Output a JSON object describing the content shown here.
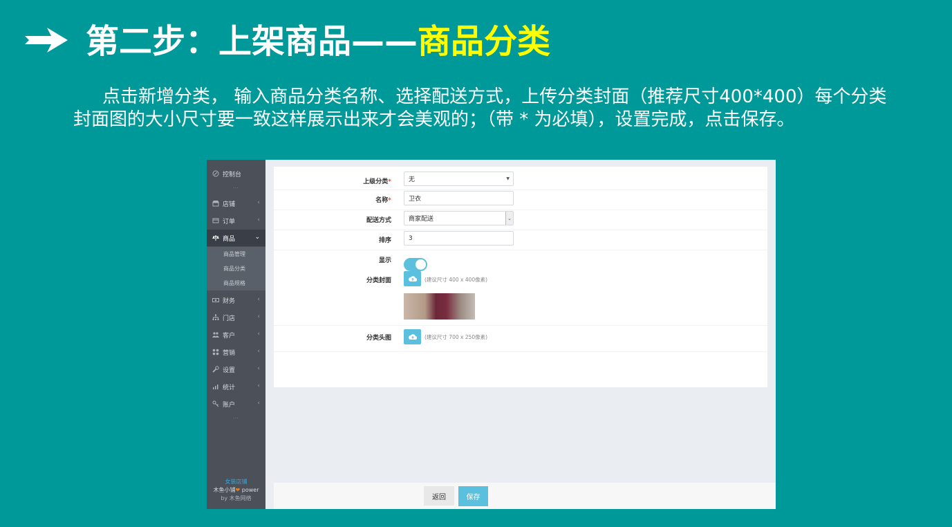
{
  "slide": {
    "title_main": "第二步：上架商品——",
    "title_highlight": "商品分类",
    "description": "点击新增分类， 输入商品分类名称、选择配送方式，上传分类封面（推荐尺寸400*400）每个分类封面图的大小尺寸要一致这样展示出来才会美观的；（带 * 为必填），设置完成，点击保存。"
  },
  "sidebar": {
    "items": [
      {
        "label": "控制台",
        "icon": "dashboard-icon"
      },
      {
        "label": "店铺",
        "icon": "store-icon"
      },
      {
        "label": "订单",
        "icon": "order-icon"
      },
      {
        "label": "商品",
        "icon": "scale-icon"
      },
      {
        "label": "财务",
        "icon": "money-icon"
      },
      {
        "label": "门店",
        "icon": "sitemap-icon"
      },
      {
        "label": "客户",
        "icon": "users-icon"
      },
      {
        "label": "营销",
        "icon": "grid-icon"
      },
      {
        "label": "设置",
        "icon": "wrench-icon"
      },
      {
        "label": "统计",
        "icon": "bar-chart-icon"
      },
      {
        "label": "账户",
        "icon": "key-icon"
      }
    ],
    "sub_items": [
      "商品管理",
      "商品分类",
      "商品规格"
    ],
    "dots": "...",
    "footer": {
      "shop_name": "女装店铺",
      "brand": "木鱼小铺",
      "power": "power",
      "by": "by 木鱼网络"
    }
  },
  "form": {
    "parent_category": {
      "label": "上级分类",
      "value": "无"
    },
    "name": {
      "label": "名称",
      "value": "卫衣"
    },
    "delivery": {
      "label": "配送方式",
      "value": "商家配送"
    },
    "sort": {
      "label": "排序",
      "value": "3"
    },
    "display": {
      "label": "显示",
      "value": true
    },
    "cover": {
      "label": "分类封面",
      "hint": "(建议尺寸 400 x 400像素)"
    },
    "header_img": {
      "label": "分类头图",
      "hint": "(建议尺寸 700 x 250像素)"
    },
    "required_mark": "*"
  },
  "footer": {
    "back_label": "返回",
    "save_label": "保存"
  },
  "colors": {
    "background": "#009999",
    "title_highlight": "#ffff00",
    "accent": "#5bc0de",
    "sidebar": "#4b5059"
  }
}
